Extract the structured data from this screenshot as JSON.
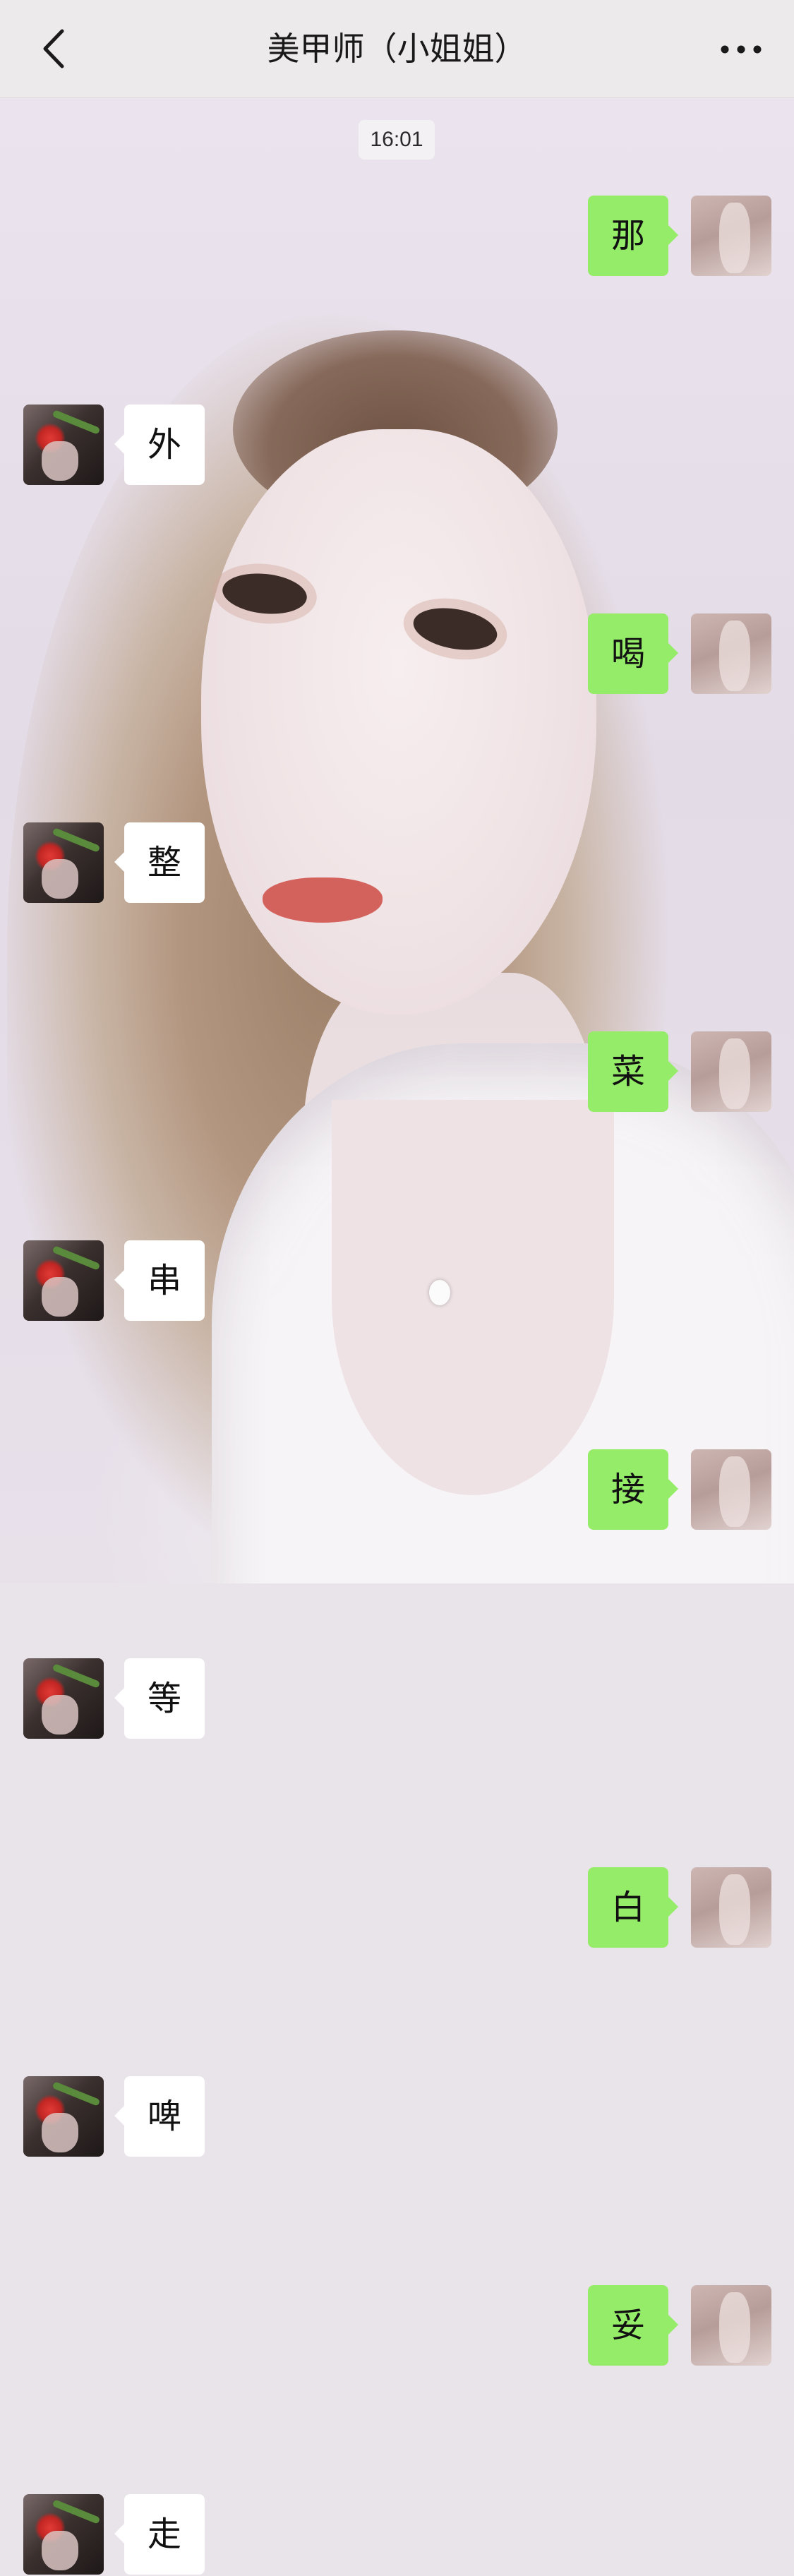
{
  "navbar": {
    "title": "美甲师（小姐姐）",
    "back_icon": "chevron-left-icon",
    "more_icon": "more-horizontal-icon"
  },
  "timestamp": "16:01",
  "colors": {
    "sent_bubble": "#95ec69",
    "received_bubble": "#ffffff",
    "navbar_bg": "#eceaeb"
  },
  "messages": [
    {
      "side": "right",
      "text": "那"
    },
    {
      "side": "left",
      "text": "外"
    },
    {
      "side": "right",
      "text": "喝"
    },
    {
      "side": "left",
      "text": "整"
    },
    {
      "side": "right",
      "text": "菜"
    },
    {
      "side": "left",
      "text": "串"
    },
    {
      "side": "right",
      "text": "接"
    },
    {
      "side": "left",
      "text": "等"
    },
    {
      "side": "right",
      "text": "白"
    },
    {
      "side": "left",
      "text": "啤"
    },
    {
      "side": "right",
      "text": "妥"
    },
    {
      "side": "left",
      "text": "走"
    }
  ]
}
